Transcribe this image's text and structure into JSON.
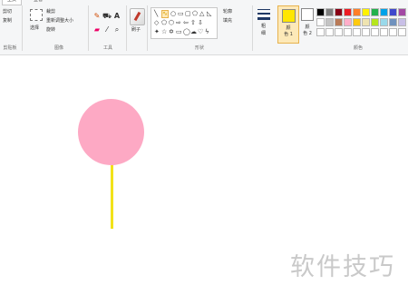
{
  "ribbon": {
    "tabs": [
      "主页",
      "查看"
    ],
    "clipboard": {
      "cut": "剪切",
      "copy": "复制",
      "group": "剪贴板"
    },
    "image": {
      "select": "选择",
      "crop": "裁剪",
      "resize": "重新调整大小",
      "rotate": "旋转",
      "group": "图像"
    },
    "tools": {
      "group": "工具",
      "text_glyph": "A"
    },
    "brush": {
      "label": "刷子"
    },
    "shapes": {
      "outline": "轮廓",
      "fill": "填充",
      "group": "形状"
    },
    "stroke": {
      "label_top": "粗",
      "label_bottom": "细"
    },
    "colors": {
      "color1_top": "颜",
      "color1_bottom": "色 1",
      "color2_top": "颜",
      "color2_bottom": "色 2",
      "group": "颜色"
    }
  },
  "colors": {
    "color1": "#ffe600",
    "color2": "#ffffff",
    "circle": "#fda9c4",
    "stick": "#f2e219"
  },
  "palette": {
    "row1": [
      "#000000",
      "#7f7f7f",
      "#880015",
      "#ed1c24",
      "#ff7f27",
      "#fff200",
      "#22b14c",
      "#00a2e8",
      "#3f48cc",
      "#a349a4"
    ],
    "row2": [
      "#ffffff",
      "#c3c3c3",
      "#b97a57",
      "#ffaec9",
      "#ffc90e",
      "#efe4b0",
      "#b5e61d",
      "#99d9ea",
      "#7092be",
      "#c8bfe7"
    ],
    "row3": [
      "#ffffff",
      "#ffffff",
      "#ffffff",
      "#ffffff",
      "#ffffff",
      "#ffffff",
      "#ffffff",
      "#ffffff",
      "#ffffff",
      "#ffffff"
    ]
  },
  "watermark": "软件技巧"
}
